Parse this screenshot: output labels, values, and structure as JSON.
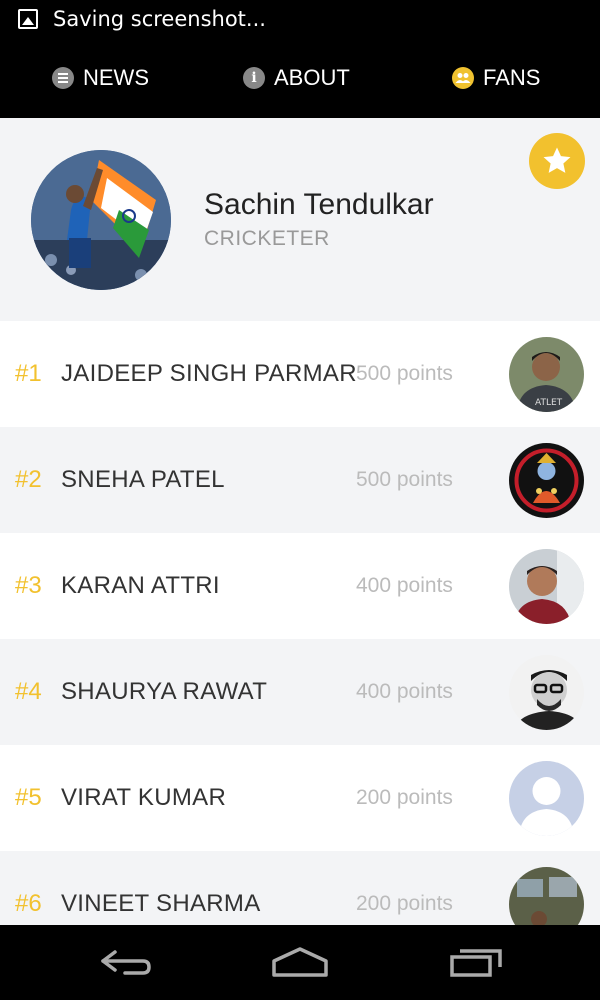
{
  "status_bar": {
    "text": "Saving screenshot..."
  },
  "nav": {
    "tabs": [
      {
        "label": "NEWS",
        "icon": "list-icon"
      },
      {
        "label": "ABOUT",
        "icon": "info-icon"
      },
      {
        "label": "FANS",
        "icon": "people-icon"
      }
    ]
  },
  "profile": {
    "name": "Sachin Tendulkar",
    "role": "CRICKETER",
    "favorite_icon": "star-icon",
    "accent": "#f2c12e"
  },
  "fans": [
    {
      "rank": "#1",
      "name": "JAIDEEP SINGH PARMAR",
      "points": "500 points"
    },
    {
      "rank": "#2",
      "name": "SNEHA PATEL",
      "points": "500 points"
    },
    {
      "rank": "#3",
      "name": "KARAN ATTRI",
      "points": "400 points"
    },
    {
      "rank": "#4",
      "name": "SHAURYA RAWAT",
      "points": "400 points"
    },
    {
      "rank": "#5",
      "name": "VIRAT KUMAR",
      "points": "200 points"
    },
    {
      "rank": "#6",
      "name": "VINEET SHARMA",
      "points": "200 points"
    }
  ],
  "system_nav": {
    "buttons": [
      "back-icon",
      "home-icon",
      "recents-icon"
    ]
  }
}
